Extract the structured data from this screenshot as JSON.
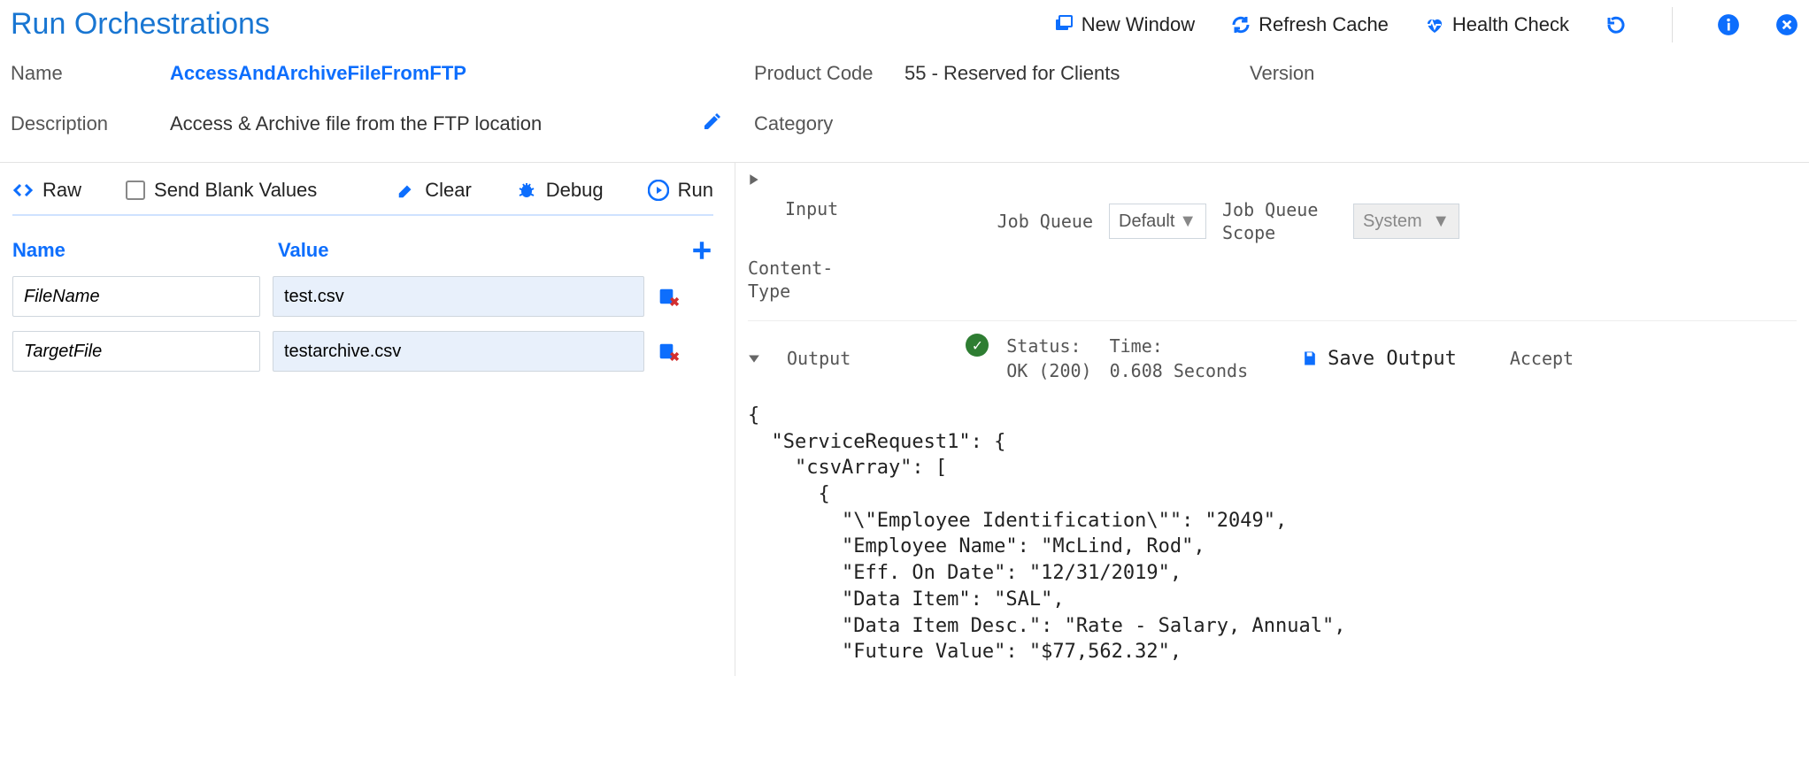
{
  "title": "Run Orchestrations",
  "toolbar": {
    "new_window": "New Window",
    "refresh_cache": "Refresh Cache",
    "health_check": "Health Check"
  },
  "meta": {
    "name_label": "Name",
    "name_value": "AccessAndArchiveFileFromFTP",
    "desc_label": "Description",
    "desc_value": "Access & Archive file from the FTP location",
    "product_code_label": "Product Code",
    "product_code_value": "55 - Reserved for Clients",
    "version_label": "Version",
    "category_label": "Category"
  },
  "actions": {
    "raw": "Raw",
    "send_blank": "Send Blank Values",
    "clear": "Clear",
    "debug": "Debug",
    "run": "Run"
  },
  "params": {
    "col_name": "Name",
    "col_value": "Value",
    "rows": [
      {
        "name": "FileName",
        "value": "test.csv"
      },
      {
        "name": "TargetFile",
        "value": "testarchive.csv"
      }
    ]
  },
  "right": {
    "input_label": "Input",
    "job_queue_label": "Job Queue",
    "job_queue_value": "Default",
    "job_queue_scope_label": "Job Queue Scope",
    "job_queue_scope_value": "System",
    "content_type_label": "Content-Type",
    "output_label": "Output",
    "status_label": "Status:",
    "status_value": "OK (200)",
    "time_label": "Time:",
    "time_value": "0.608 Seconds",
    "save_output": "Save Output",
    "accept": "Accept"
  },
  "json_output": "{\n  \"ServiceRequest1\": {\n    \"csvArray\": [\n      {\n        \"\\\"Employee Identification\\\"\": \"2049\",\n        \"Employee Name\": \"McLind, Rod\",\n        \"Eff. On Date\": \"12/31/2019\",\n        \"Data Item\": \"SAL\",\n        \"Data Item Desc.\": \"Rate - Salary, Annual\",\n        \"Future Value\": \"$77,562.32\","
}
